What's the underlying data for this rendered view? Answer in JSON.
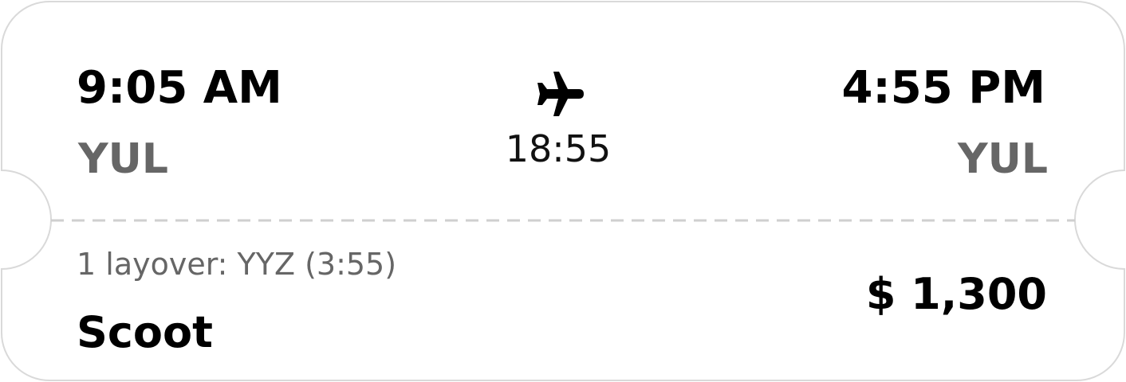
{
  "flight": {
    "departure_time": "9:05 AM",
    "departure_airport": "YUL",
    "arrival_time": "4:55 PM",
    "arrival_airport": "YUL",
    "duration": "18:55",
    "layover_text": "1 layover:  YYZ (3:55)",
    "airline": "Scoot",
    "price": "$ 1,300",
    "icon": "airplane-icon"
  },
  "colors": {
    "card_border": "#d9d9d9",
    "divider": "#cfcfcf",
    "muted_text": "#666666",
    "primary_text": "#000000"
  }
}
